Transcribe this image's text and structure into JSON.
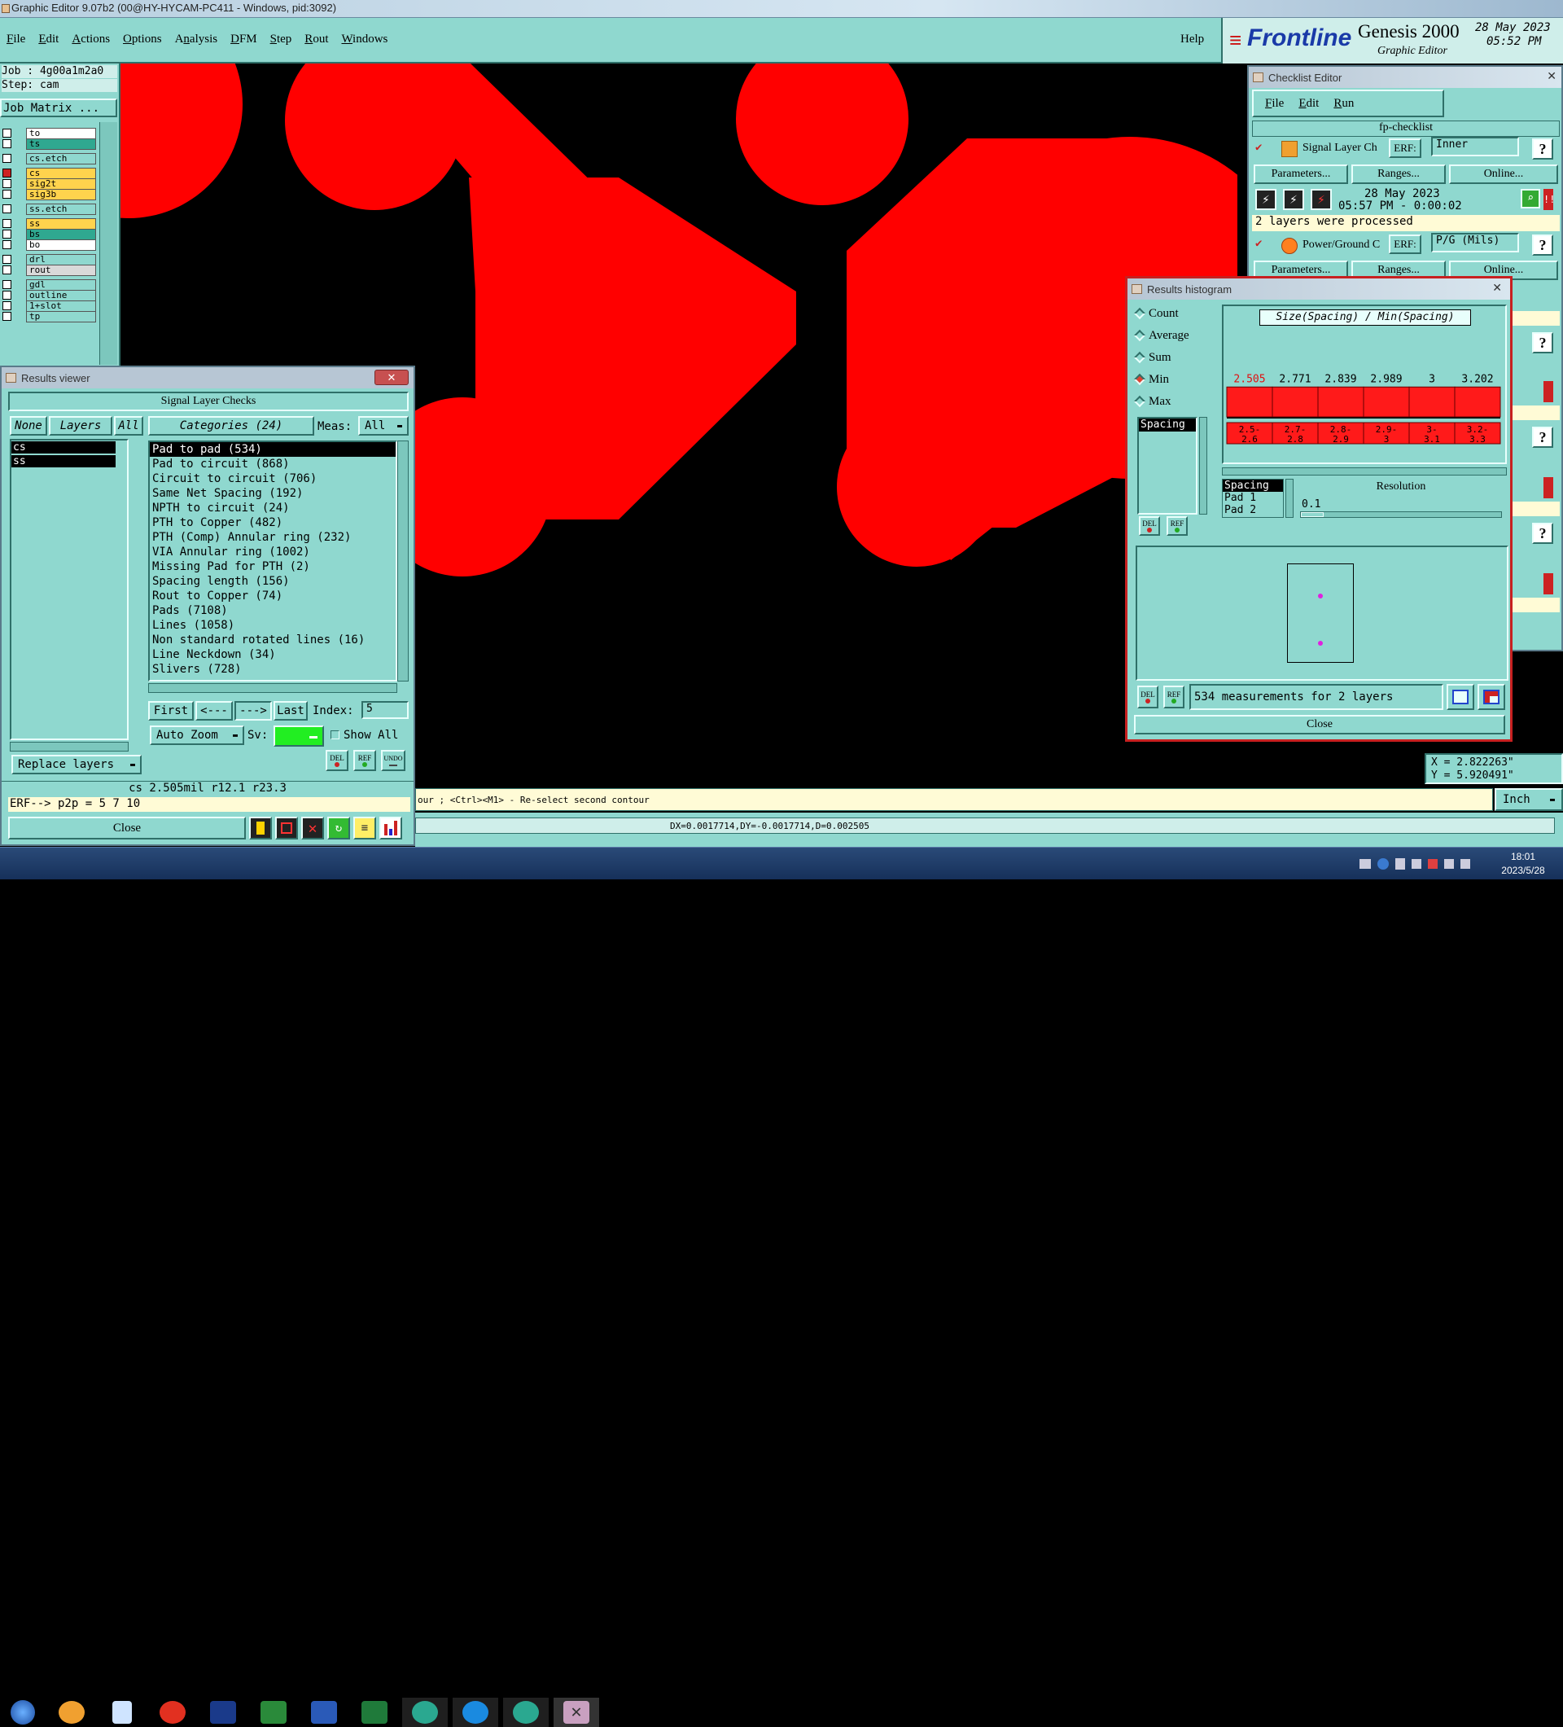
{
  "window": {
    "title": "Graphic Editor 9.07b2 (00@HY-HYCAM-PC411 - Windows, pid:3092)"
  },
  "menu": {
    "items": [
      "File",
      "Edit",
      "Actions",
      "Options",
      "Analysis",
      "DFM",
      "Step",
      "Rout",
      "Windows"
    ],
    "help": "Help"
  },
  "brand": {
    "logo": "Frontline",
    "product": "Genesis 2000",
    "subtitle": "Graphic Editor",
    "date": "28 May 2023",
    "time": "05:52 PM"
  },
  "job": {
    "job_label": "Job : 4g00a1m2a0",
    "step_label": "Step: cam",
    "matrix_button": "Job Matrix ..."
  },
  "layers": [
    {
      "name": "to",
      "color": "#ffffff"
    },
    {
      "name": "ts",
      "color": "#2fa890"
    },
    {
      "name": "cs.etch",
      "color": "#8fd8cf"
    },
    {
      "name": "cs",
      "color": "#ffd34d"
    },
    {
      "name": "sig2t",
      "color": "#ffd34d"
    },
    {
      "name": "sig3b",
      "color": "#ffd34d"
    },
    {
      "name": "ss.etch",
      "color": "#8fd8cf"
    },
    {
      "name": "ss",
      "color": "#ffd34d"
    },
    {
      "name": "bs",
      "color": "#2fa890"
    },
    {
      "name": "bo",
      "color": "#ffffff"
    },
    {
      "name": "drl",
      "color": "#8fd8cf"
    },
    {
      "name": "rout",
      "color": "#d9d9d9"
    },
    {
      "name": "gdl",
      "color": "#8fd8cf"
    },
    {
      "name": "outline",
      "color": "#8fd8cf"
    },
    {
      "name": "1+slot",
      "color": "#8fd8cf"
    },
    {
      "name": "tp",
      "color": "#8fd8cf"
    }
  ],
  "results_viewer": {
    "title": "Results viewer",
    "check_name": "Signal Layer Checks",
    "none_btn": "None",
    "layers_btn": "Layers",
    "all_btn": "All",
    "categories_label": "Categories (24)",
    "meas_label": "Meas:",
    "meas_value": "All",
    "layer_list": [
      "cs",
      "ss"
    ],
    "categories": [
      "Pad to pad (534)",
      "Pad to circuit (868)",
      "Circuit to circuit (706)",
      "Same Net Spacing (192)",
      "NPTH to circuit (24)",
      "PTH to Copper (482)",
      "PTH (Comp) Annular ring (232)",
      "VIA Annular ring (1002)",
      "Missing Pad for PTH (2)",
      "Spacing length (156)",
      "Rout to Copper (74)",
      "Pads (7108)",
      "Lines (1058)",
      "Non standard rotated lines (16)",
      "Line Neckdown (34)",
      "Slivers (728)"
    ],
    "first": "First",
    "prev": "<---",
    "next": "--->",
    "last": "Last",
    "index_label": "Index:",
    "index_value": "5",
    "auto_zoom": "Auto Zoom",
    "sv_label": "Sv:",
    "show_all": "Show All",
    "replace_layers": "Replace layers",
    "status": "cs 2.505mil  r12.1  r23.3",
    "erf_line": "ERF--> p2p = 5 7 10",
    "close": "Close",
    "del": "DEL",
    "ref": "REF",
    "undo": "UNDO"
  },
  "checklist": {
    "title": "Checklist Editor",
    "menu": [
      "File",
      "Edit",
      "Run"
    ],
    "name": "fp-checklist",
    "rows": [
      {
        "label": "Signal Layer Ch",
        "erf": "ERF:",
        "erf_value": "Inner",
        "params": "Parameters...",
        "ranges": "Ranges...",
        "online": "Online...",
        "date": "28 May 2023",
        "time": "05:57 PM - 0:00:02",
        "message": "2 layers were processed"
      },
      {
        "label": "Power/Ground C",
        "erf": "ERF:",
        "erf_value": "P/G (Mils)",
        "params": "Parameters...",
        "ranges": "Ranges...",
        "online": "Online..."
      }
    ]
  },
  "histogram": {
    "title": "Results histogram",
    "options": [
      {
        "label": "Count",
        "selected": false
      },
      {
        "label": "Average",
        "selected": false
      },
      {
        "label": "Sum",
        "selected": false
      },
      {
        "label": "Min",
        "selected": true
      },
      {
        "label": "Max",
        "selected": false
      }
    ],
    "list_item": "Spacing",
    "chart_title": "Size(Spacing) / Min(Spacing)",
    "selected_value": "2.505",
    "bins": [
      {
        "value": "2.505",
        "range": "2.5-2.6",
        "bar": 0.27
      },
      {
        "value": "2.771",
        "range": "2.7-2.8",
        "bar": 0.27
      },
      {
        "value": "2.839",
        "range": "2.8-2.9",
        "bar": 0.27
      },
      {
        "value": "2.989",
        "range": "2.9-3",
        "bar": 0.27
      },
      {
        "value": "3",
        "range": "3-3.1",
        "bar": 0.27
      },
      {
        "value": "3.202",
        "range": "3.2-3.3",
        "bar": 0.27
      }
    ],
    "detail_rows": [
      "Spacing",
      "Pad 1",
      "Pad 2"
    ],
    "resolution_label": "Resolution",
    "resolution_value": "0.1",
    "summary": "534 measurements for 2 layers",
    "close": "Close",
    "del": "DEL",
    "ref": "REF"
  },
  "coords": {
    "x": "X = 2.822263\"",
    "y": "Y = 5.920491\""
  },
  "hint_bar": "our ; <Ctrl><M1> - Re-select second contour",
  "units": "Inch",
  "measure_bar": "DX=0.0017714,DY=-0.0017714,D=0.002505",
  "taskbar": {
    "time": "18:01",
    "date": "2023/5/28"
  },
  "colors": {
    "panel": "#8fd8cf",
    "copper": "#ff0000",
    "canvas": "#000000",
    "highlight": "#2fa890"
  }
}
